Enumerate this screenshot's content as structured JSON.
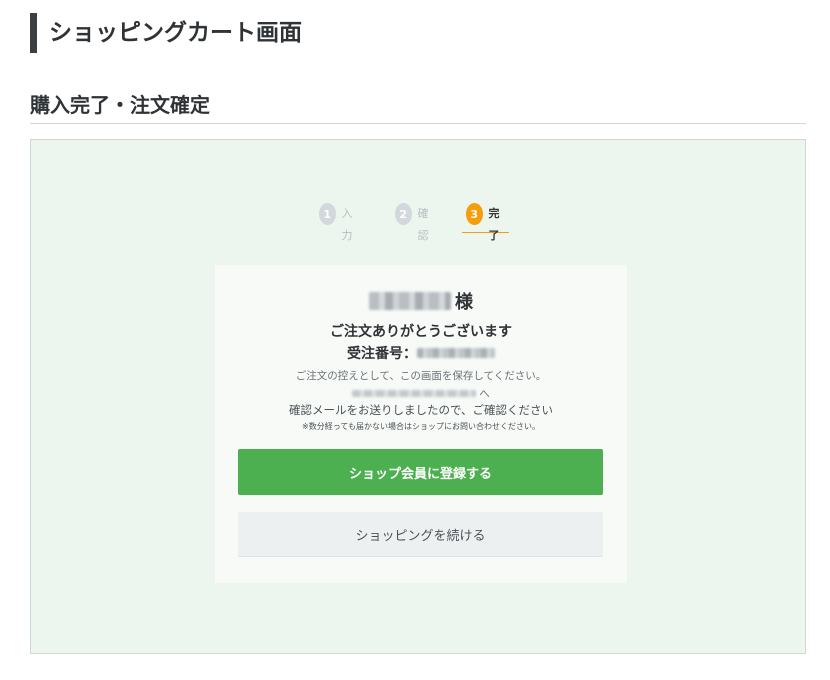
{
  "page": {
    "title": "ショッピングカート画面",
    "section_title": "購入完了・注文確定"
  },
  "steps": [
    {
      "number": "1",
      "label": "入力",
      "active": false
    },
    {
      "number": "2",
      "label": "確認",
      "active": false
    },
    {
      "number": "3",
      "label": "完了",
      "active": true
    }
  ],
  "confirmation": {
    "customer_suffix": "様",
    "thanks_message": "ご注文ありがとうございます",
    "order_number_label": "受注番号：",
    "save_note": "ご注文の控えとして、この画面を保存してください。",
    "email_suffix": "へ",
    "email_sent_note": "確認メールをお送りしましたので、ご確認ください",
    "not_received_note": "※数分経っても届かない場合はショップにお問い合わせください。"
  },
  "buttons": {
    "register_member": "ショップ会員に登録する",
    "continue_shopping": "ショッピングを続ける"
  },
  "colors": {
    "accent_green": "#4caf50",
    "step_active": "#f59e0b",
    "step_inactive": "#d3d8dc",
    "preview_background": "#edf6ee"
  }
}
